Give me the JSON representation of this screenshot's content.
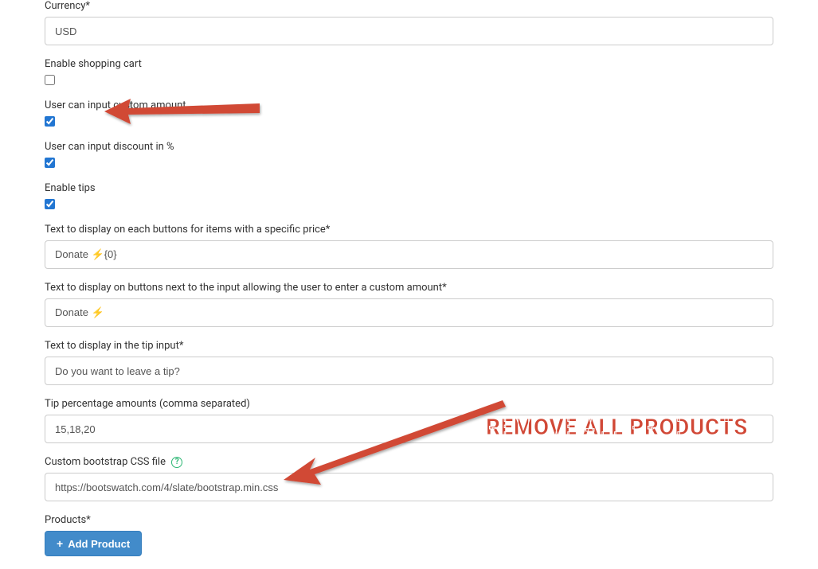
{
  "currency": {
    "label": "Currency*",
    "value": "USD"
  },
  "shopping_cart": {
    "label": "Enable shopping cart",
    "checked": false
  },
  "custom_amount": {
    "label": "User can input custom amount",
    "checked": true
  },
  "discount": {
    "label": "User can input discount in %",
    "checked": true
  },
  "tips": {
    "label": "Enable tips",
    "checked": true
  },
  "button_text_specific": {
    "label": "Text to display on each buttons for items with a specific price*",
    "value": "Donate ⚡️{0}"
  },
  "button_text_custom": {
    "label": "Text to display on buttons next to the input allowing the user to enter a custom amount*",
    "value": "Donate ⚡️"
  },
  "tip_text": {
    "label": "Text to display in the tip input*",
    "value": "Do you want to leave a tip?"
  },
  "tip_amounts": {
    "label": "Tip percentage amounts (comma separated)",
    "value": "15,18,20"
  },
  "bootstrap_css": {
    "label": "Custom bootstrap CSS file",
    "value": "https://bootswatch.com/4/slate/bootstrap.min.css"
  },
  "products": {
    "label": "Products*",
    "add_button": "Add Product"
  },
  "annotation": {
    "remove_text": "REMOVE ALL PRODUCTS"
  }
}
